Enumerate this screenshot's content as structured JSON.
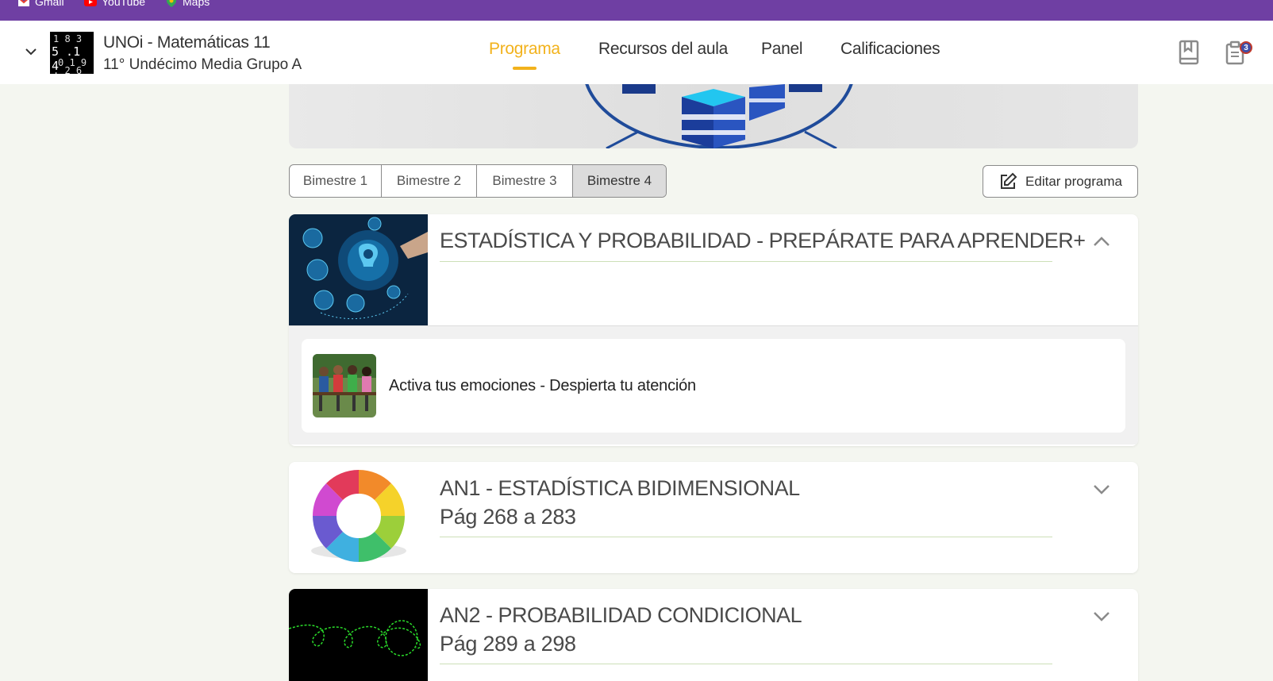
{
  "bookmarks": [
    {
      "label": "Gmail",
      "icon": "gmail-icon"
    },
    {
      "label": "YouTube",
      "icon": "youtube-icon"
    },
    {
      "label": "Maps",
      "icon": "maps-icon"
    }
  ],
  "course": {
    "title": "UNOi - Matemáticas 11",
    "subtitle": "11° Undécimo Media Grupo A"
  },
  "nav": [
    {
      "label": "Programa",
      "active": true
    },
    {
      "label": "Recursos del aula"
    },
    {
      "label": "Panel"
    },
    {
      "label": "Calificaciones"
    }
  ],
  "header_icons": [
    "book-icon",
    "clipboard-icon"
  ],
  "notifications_count": "3",
  "tabs": [
    {
      "label": "Bimestre 1"
    },
    {
      "label": "Bimestre 2"
    },
    {
      "label": "Bimestre 3"
    },
    {
      "label": "Bimestre 4",
      "selected": true
    }
  ],
  "edit_button": {
    "label": "Editar programa",
    "icon": "edit-icon"
  },
  "units": [
    {
      "title": "ESTADÍSTICA Y PROBABILIDAD - PREPÁRATE PARA APRENDER+",
      "pages": "",
      "expanded": true,
      "lessons": [
        {
          "label": "Activa tus emociones - Despierta tu atención"
        }
      ]
    },
    {
      "title": "AN1 - ESTADÍSTICA BIDIMENSIONAL",
      "pages": "Pág 268 a 283",
      "expanded": false
    },
    {
      "title": "AN2 - PROBABILIDAD CONDICIONAL",
      "pages": "Pág 289 a 298",
      "expanded": false
    }
  ],
  "colors": {
    "bookmark_bar": "#6f3fa3",
    "accent": "#f2b21c",
    "page_bg": "#f4f6f0"
  }
}
